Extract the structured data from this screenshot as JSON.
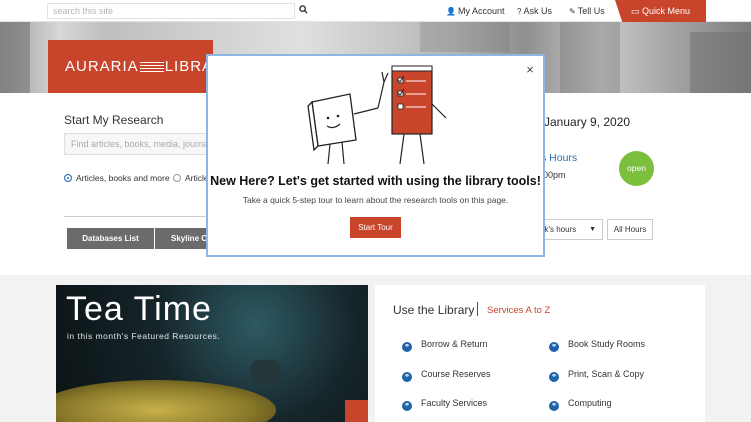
{
  "topbar": {
    "search_placeholder": "search this site",
    "links": [
      {
        "icon": "person-icon",
        "glyph": "👤",
        "label": "My Account"
      },
      {
        "icon": "question-icon",
        "glyph": "?",
        "label": "Ask Us"
      },
      {
        "icon": "pin-icon",
        "glyph": "✎",
        "label": "Tell Us"
      }
    ],
    "quick_menu": {
      "icon": "menu-icon",
      "glyph": "▭",
      "label": "Quick Menu"
    },
    "accent": "#c8452c"
  },
  "logo": {
    "left": "AURARIA",
    "right": "LIBRA"
  },
  "research": {
    "title": "Start My Research",
    "input_placeholder": "Find articles, books, media, journa",
    "radios": [
      {
        "label": "Articles, books and more",
        "selected": true
      },
      {
        "label": "Article",
        "selected": false
      }
    ],
    "tabs": [
      "Databases List",
      "Skyline C"
    ]
  },
  "hours": {
    "date": "January 9, 2020",
    "link_label": "s Hours",
    "time": "00pm",
    "status": "open",
    "status_color": "#7bbf3c",
    "week_select": "ek's hours",
    "all_hours": "All Hours"
  },
  "feature": {
    "title": "Tea Time",
    "subtitle": "in this month's Featured Resources."
  },
  "use_library": {
    "title": "Use the Library",
    "link": "Services A to Z",
    "services_left": [
      "Borrow & Return",
      "Course Reserves",
      "Faculty Services"
    ],
    "services_right": [
      "Book Study Rooms",
      "Print, Scan & Copy",
      "Computing"
    ]
  },
  "modal": {
    "close_glyph": "×",
    "heading": "New Here? Let's get started with using the library tools!",
    "sub": "Take a quick 5-step tour to learn about the research tools on this page.",
    "button": "Start Tour",
    "border_color": "#8fb6e3"
  }
}
